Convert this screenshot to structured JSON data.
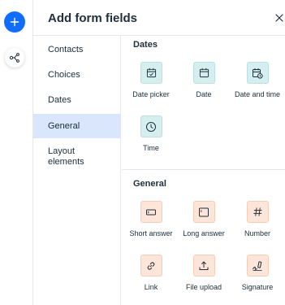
{
  "header": {
    "title": "Add form fields"
  },
  "categories": [
    {
      "label": "Contacts"
    },
    {
      "label": "Choices"
    },
    {
      "label": "Dates"
    },
    {
      "label": "General"
    },
    {
      "label": "Layout elements"
    }
  ],
  "selected_category": "General",
  "sections": {
    "dates": {
      "title": "Dates",
      "fields": [
        {
          "label": "Date picker",
          "icon": "calendar-check-icon"
        },
        {
          "label": "Date",
          "icon": "calendar-icon"
        },
        {
          "label": "Date and time",
          "icon": "calendar-clock-icon"
        },
        {
          "label": "Time",
          "icon": "clock-icon"
        }
      ]
    },
    "general": {
      "title": "General",
      "fields": [
        {
          "label": "Short answer",
          "icon": "short-answer-icon"
        },
        {
          "label": "Long answer",
          "icon": "long-answer-icon"
        },
        {
          "label": "Number",
          "icon": "hash-icon"
        },
        {
          "label": "Link",
          "icon": "link-icon"
        },
        {
          "label": "File upload",
          "icon": "upload-icon"
        },
        {
          "label": "Signature",
          "icon": "signature-icon"
        }
      ]
    }
  },
  "colors": {
    "accent": "#116dff",
    "selected_bg": "#d9e6fb",
    "date_tile": "#d5eef0",
    "general_tile": "#fde5d9"
  }
}
